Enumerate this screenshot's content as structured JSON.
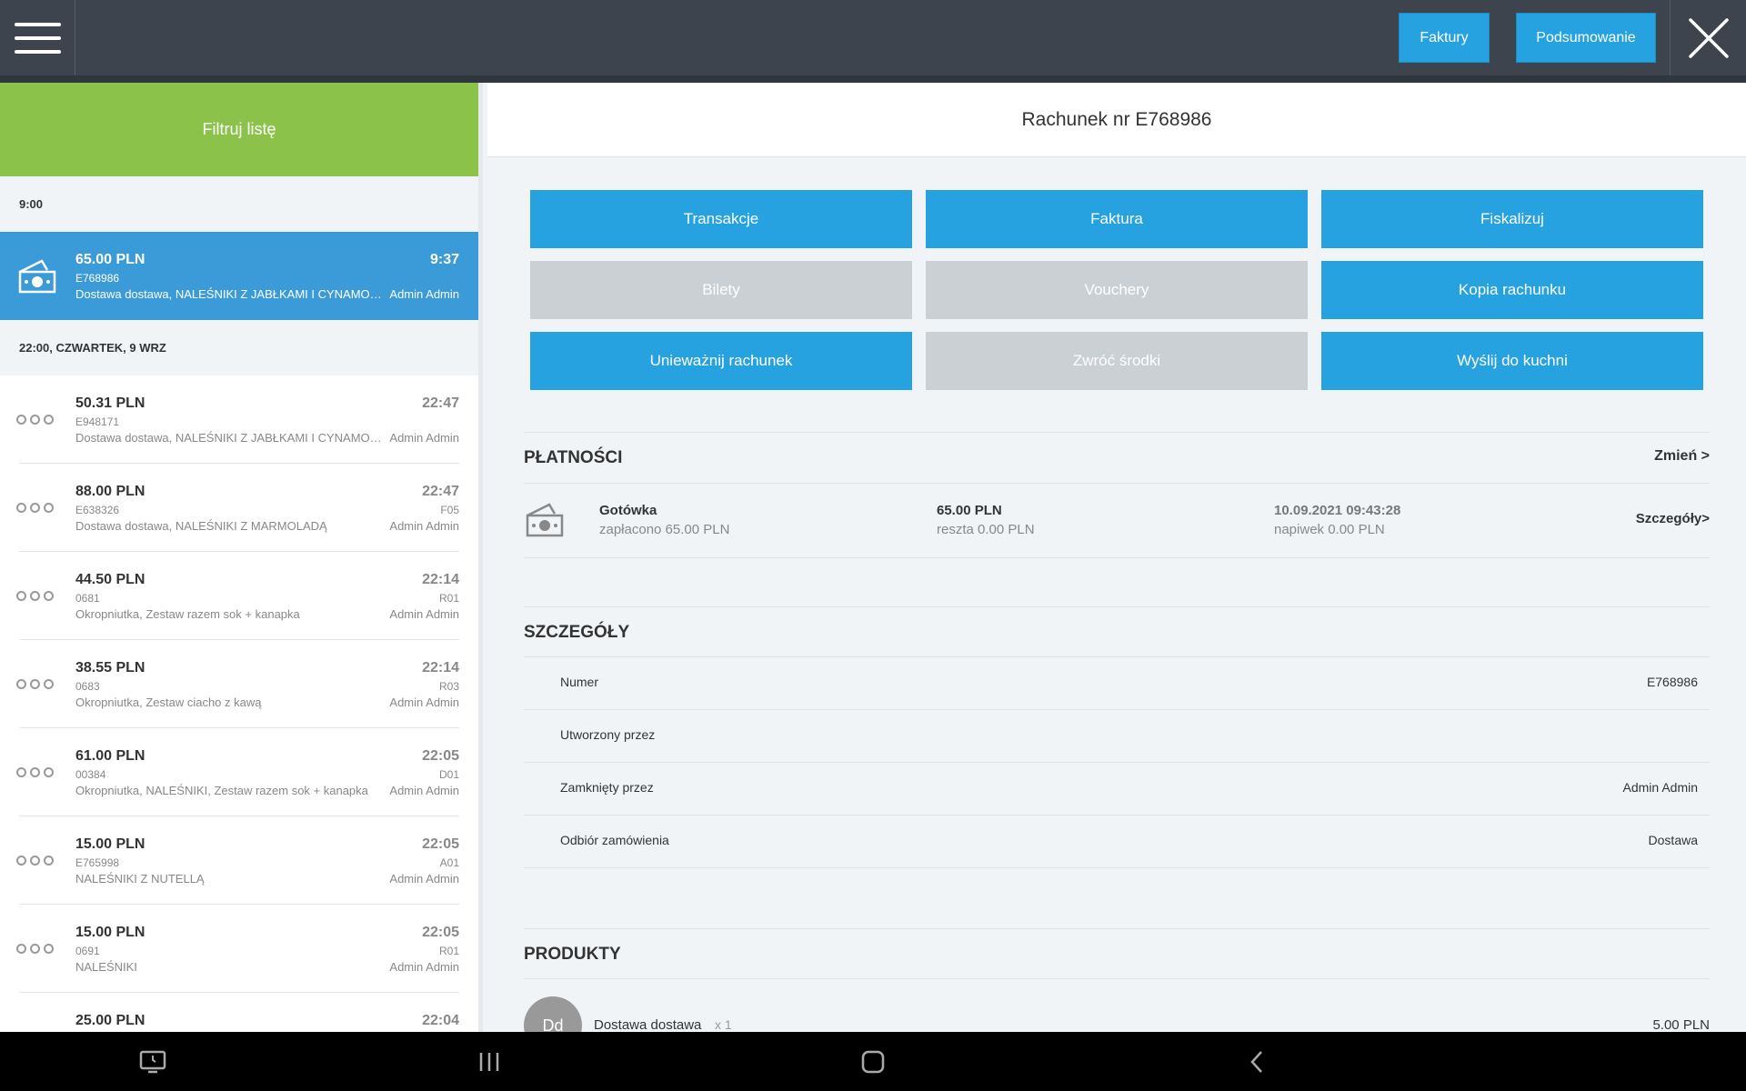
{
  "topbar": {
    "invoices_label": "Faktury",
    "summary_label": "Podsumowanie"
  },
  "left": {
    "filter_label": "Filtruj listę",
    "group1": "9:00",
    "group2": "22:00, CZWARTEK, 9 WRZ",
    "active": {
      "amount": "65.00 PLN",
      "number": "E768986",
      "items": "Dostawa dostawa, NALEŚNIKI Z JABŁKAMI I CYNAMONEM",
      "time": "9:37",
      "table": "",
      "user": "Admin Admin"
    },
    "receipts": [
      {
        "amount": "50.31 PLN",
        "number": "E948171",
        "items": "Dostawa dostawa, NALEŚNIKI Z JABŁKAMI I CYNAMONEM",
        "time": "22:47",
        "table": "",
        "user": "Admin Admin"
      },
      {
        "amount": "88.00 PLN",
        "number": "E638326",
        "items": "Dostawa dostawa, NALEŚNIKI Z MARMOLADĄ",
        "time": "22:47",
        "table": "F05",
        "user": "Admin Admin"
      },
      {
        "amount": "44.50 PLN",
        "number": "0681",
        "items": "Okropniutka, Zestaw razem sok + kanapka",
        "time": "22:14",
        "table": "R01",
        "user": "Admin Admin"
      },
      {
        "amount": "38.55 PLN",
        "number": "0683",
        "items": "Okropniutka, Zestaw ciacho z kawą",
        "time": "22:14",
        "table": "R03",
        "user": "Admin Admin"
      },
      {
        "amount": "61.00 PLN",
        "number": "00384",
        "items": "Okropniutka, NALEŚNIKI, Zestaw razem sok + kanapka",
        "time": "22:05",
        "table": "D01",
        "user": "Admin Admin"
      },
      {
        "amount": "15.00 PLN",
        "number": "E765998",
        "items": "NALEŚNIKI Z NUTELLĄ",
        "time": "22:05",
        "table": "A01",
        "user": "Admin Admin"
      },
      {
        "amount": "15.00 PLN",
        "number": "0691",
        "items": "NALEŚNIKI",
        "time": "22:05",
        "table": "R01",
        "user": "Admin Admin"
      },
      {
        "amount": "25.00 PLN",
        "number": "",
        "items": "",
        "time": "22:04",
        "table": "",
        "user": ""
      }
    ]
  },
  "right": {
    "title": "Rachunek nr E768986",
    "actions": {
      "transactions": "Transakcje",
      "invoice": "Faktura",
      "fiscalize": "Fiskalizuj",
      "tickets": "Bilety",
      "vouchers": "Vouchery",
      "copy": "Kopia rachunku",
      "cancel": "Unieważnij rachunek",
      "refund": "Zwróć środki",
      "kitchen": "Wyślij do kuchni"
    },
    "payments": {
      "title": "PŁATNOŚCI",
      "change_label": "Zmień >",
      "method": "Gotówka",
      "paid": "zapłacono 65.00 PLN",
      "amount": "65.00 PLN",
      "change": "reszta 0.00 PLN",
      "date": "10.09.2021 09:43:28",
      "tip": "napiwek 0.00 PLN",
      "details_label": "Szczegóły>"
    },
    "details": {
      "title": "SZCZEGÓŁY",
      "rows": [
        {
          "label": "Numer",
          "value": "E768986"
        },
        {
          "label": "Utworzony przez",
          "value": ""
        },
        {
          "label": "Zamknięty przez",
          "value": "Admin Admin"
        },
        {
          "label": "Odbiór zamówienia",
          "value": "Dostawa"
        }
      ]
    },
    "products": {
      "title": "PRODUKTY",
      "items": [
        {
          "avatar": "Dd",
          "name": "Dostawa dostawa",
          "qty": "x 1",
          "price": "5.00 PLN"
        }
      ]
    }
  },
  "colors": {
    "topbar": "#3d444d",
    "accent_blue": "#26a2e0",
    "active_row": "#3b9bd8",
    "filter_green": "#8bc34a",
    "disabled_gray": "#cbd0d4"
  }
}
